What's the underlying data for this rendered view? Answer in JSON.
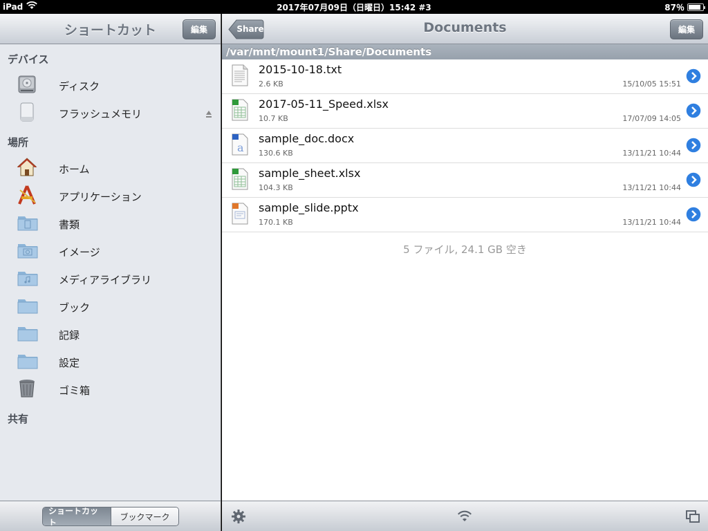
{
  "status": {
    "carrier": "iPad",
    "clock": "2017年07月09日（日曜日）15:42 #3",
    "battery": "87％",
    "battery_level": 0.87
  },
  "sidebar": {
    "title": "ショートカット",
    "edit_label": "編集",
    "sections": [
      {
        "header": "デバイス",
        "items": [
          {
            "label": "ディスク",
            "icon": "disk-icon"
          },
          {
            "label": "フラッシュメモリ",
            "icon": "flash-memory-icon",
            "eject": true
          }
        ]
      },
      {
        "header": "場所",
        "items": [
          {
            "label": "ホーム",
            "icon": "home-icon"
          },
          {
            "label": "アプリケーション",
            "icon": "applications-icon"
          },
          {
            "label": "書類",
            "icon": "documents-folder-icon"
          },
          {
            "label": "イメージ",
            "icon": "images-folder-icon"
          },
          {
            "label": "メディアライブラリ",
            "icon": "media-library-folder-icon"
          },
          {
            "label": "ブック",
            "icon": "book-folder-icon"
          },
          {
            "label": "記録",
            "icon": "records-folder-icon"
          },
          {
            "label": "設定",
            "icon": "settings-folder-icon"
          },
          {
            "label": "ゴミ箱",
            "icon": "trash-icon"
          }
        ]
      },
      {
        "header": "共有",
        "items": []
      }
    ],
    "segments": {
      "shortcut": "ショートカット",
      "bookmark": "ブックマーク",
      "selected": "shortcut"
    }
  },
  "main": {
    "back_label": "Share",
    "title": "Documents",
    "edit_label": "編集",
    "path": "/var/mnt/mount1/Share/Documents",
    "files": [
      {
        "name": "2015-10-18.txt",
        "size": "2.6 KB",
        "date": "15/10/05 15:51",
        "type": "text-file-icon"
      },
      {
        "name": "2017-05-11_Speed.xlsx",
        "size": "10.7 KB",
        "date": "17/07/09 14:05",
        "type": "spreadsheet-file-icon"
      },
      {
        "name": "sample_doc.docx",
        "size": "130.6 KB",
        "date": "13/11/21 10:44",
        "type": "word-file-icon"
      },
      {
        "name": "sample_sheet.xlsx",
        "size": "104.3 KB",
        "date": "13/11/21 10:44",
        "type": "spreadsheet-file-icon"
      },
      {
        "name": "sample_slide.pptx",
        "size": "170.1 KB",
        "date": "13/11/21 10:44",
        "type": "presentation-file-icon"
      }
    ],
    "summary": "5 ファイル, 24.1 GB 空き"
  },
  "colors": {
    "accent_blue": "#2f7fe0",
    "sidebar_bg": "#e6e9ee",
    "path_bar": "#9ea8b3"
  }
}
